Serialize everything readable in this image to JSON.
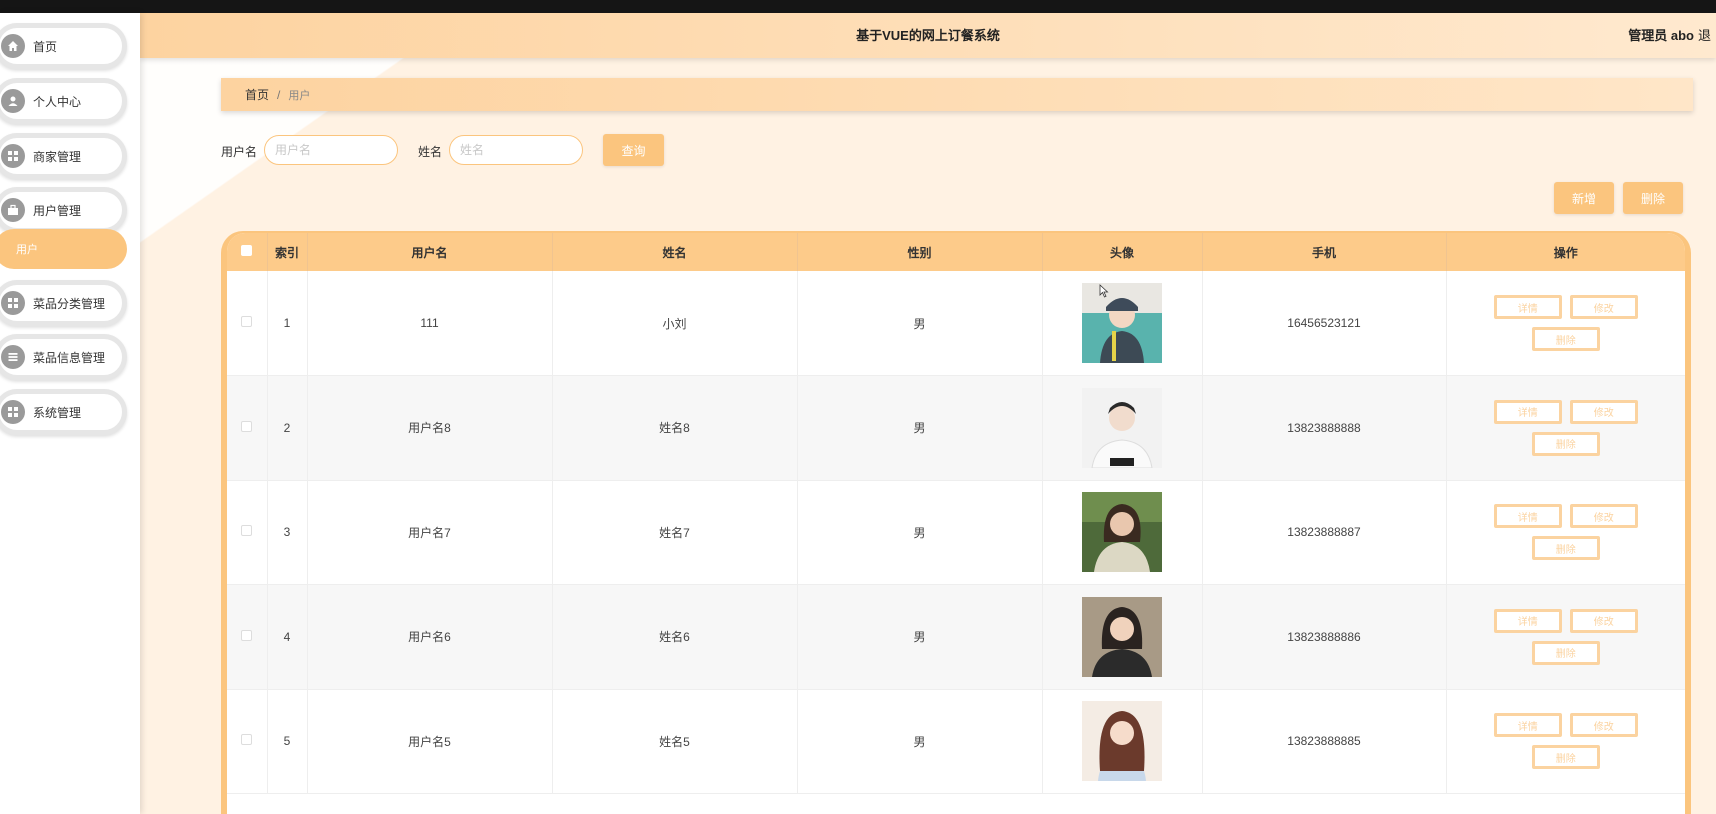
{
  "app": {
    "title": "基于VUE的网上订餐系统",
    "user_label": "管理员 abo",
    "logout_label": "退出"
  },
  "sidebar": {
    "items": [
      {
        "label": "首页",
        "icon": "home-icon"
      },
      {
        "label": "个人中心",
        "icon": "user-icon"
      },
      {
        "label": "商家管理",
        "icon": "grid-icon"
      },
      {
        "label": "用户管理",
        "icon": "briefcase-icon"
      },
      {
        "label": "菜品分类管理",
        "icon": "grid-icon"
      },
      {
        "label": "菜品信息管理",
        "icon": "list-icon"
      },
      {
        "label": "系统管理",
        "icon": "grid-icon"
      }
    ],
    "active_sub": "用户"
  },
  "breadcrumb": {
    "home": "首页",
    "separator": "/",
    "current": "用户"
  },
  "search": {
    "username_label": "用户名",
    "username_placeholder": "用户名",
    "name_label": "姓名",
    "name_placeholder": "姓名",
    "query_button": "查询"
  },
  "actions": {
    "add_button": "新增",
    "delete_button": "删除"
  },
  "table": {
    "headers": [
      "索引",
      "用户名",
      "姓名",
      "性别",
      "头像",
      "手机",
      "操作"
    ],
    "rows": [
      {
        "index": "1",
        "username": "111",
        "name": "小刘",
        "gender": "男",
        "phone": "16456523121"
      },
      {
        "index": "2",
        "username": "用户名8",
        "name": "姓名8",
        "gender": "男",
        "phone": "13823888888"
      },
      {
        "index": "3",
        "username": "用户名7",
        "name": "姓名7",
        "gender": "男",
        "phone": "13823888887"
      },
      {
        "index": "4",
        "username": "用户名6",
        "name": "姓名6",
        "gender": "男",
        "phone": "13823888886"
      },
      {
        "index": "5",
        "username": "用户名5",
        "name": "姓名5",
        "gender": "男",
        "phone": "13823888885"
      }
    ],
    "row_actions": {
      "detail": "详情",
      "edit": "修改",
      "delete": "删除"
    }
  },
  "colors": {
    "accent": "#fbc57e",
    "header_bg": "#fdd3a0",
    "main_bg": "#fff2e3"
  }
}
